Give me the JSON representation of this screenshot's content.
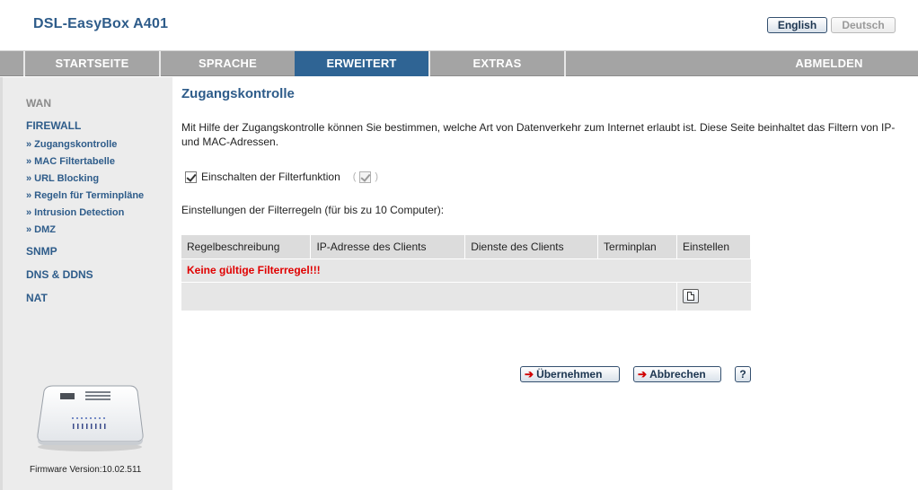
{
  "header": {
    "brand": "DSL-EasyBox A401",
    "lang_en": "English",
    "lang_de": "Deutsch"
  },
  "nav": {
    "items": [
      {
        "label": "STARTSEITE"
      },
      {
        "label": "SPRACHE"
      },
      {
        "label": "ERWEITERT"
      },
      {
        "label": "EXTRAS"
      },
      {
        "label": "ABMELDEN"
      }
    ],
    "active": "ERWEITERT"
  },
  "sidebar": {
    "categories": [
      {
        "label": "WAN"
      },
      {
        "label": "FIREWALL"
      },
      {
        "label": "SNMP"
      },
      {
        "label": "DNS & DDNS"
      },
      {
        "label": "NAT"
      }
    ],
    "subitems": [
      {
        "label": "Zugangskontrolle"
      },
      {
        "label": "MAC Filtertabelle"
      },
      {
        "label": "URL Blocking"
      },
      {
        "label": "Regeln für Terminpläne"
      },
      {
        "label": "Intrusion Detection"
      },
      {
        "label": "DMZ"
      }
    ],
    "bullet": "»",
    "firmware": "Firmware Version:10.02.511"
  },
  "main": {
    "title": "Zugangskontrolle",
    "intro": "Mit Hilfe der Zugangskontrolle können Sie bestimmen, welche Art von Datenverkehr zum Internet erlaubt ist. Diese Seite beinhaltet das Filtern von IP- und MAC-Adressen.",
    "enable_label": "Einschalten der Filterfunktion",
    "enable_checked": true,
    "paren_open": "(",
    "paren_close": ")",
    "settings_heading": "Einstellungen der Filterregeln (für bis zu 10 Computer):",
    "table": {
      "headers": [
        "Regelbeschreibung",
        "IP-Adresse des Clients",
        "Dienste des Clients",
        "Terminplan",
        "Einstellen"
      ],
      "empty_message": "Keine gültige Filterregel!!!"
    },
    "buttons": {
      "apply": "Übernehmen",
      "cancel": "Abbrechen",
      "help": "?",
      "arrow": "➔"
    }
  },
  "colors": {
    "brand_blue": "#2e5c8a",
    "nav_gray": "#a4a4a4",
    "nav_active": "#2f6494",
    "error_red": "#e00000"
  },
  "icons": {
    "device": "router-device-icon",
    "new_rule": "new-document-icon",
    "arrow": "red-arrow-icon"
  }
}
